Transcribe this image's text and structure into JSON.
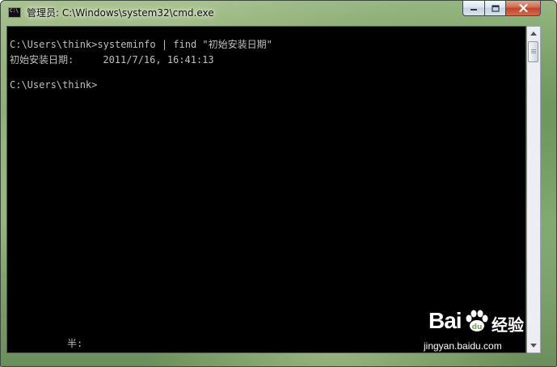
{
  "window": {
    "title": "管理员: C:\\Windows\\system32\\cmd.exe",
    "icon_text": "C:\\"
  },
  "console": {
    "lines": [
      "C:\\Users\\think>systeminfo | find \"初始安装日期\"",
      "初始安装日期:     2011/7/16, 16:41:13",
      "C:\\Users\\think>",
      "半:"
    ]
  },
  "watermark": {
    "logo_left": "Bai",
    "logo_right": "经验",
    "url": "jingyan.baidu.com"
  },
  "colors": {
    "console_bg": "#000000",
    "console_text": "#c0c0c0",
    "close_button": "#c2442a"
  },
  "icons": [
    "cmd-app-icon",
    "minimize-icon",
    "maximize-icon",
    "close-icon",
    "scroll-up-icon",
    "scroll-down-icon",
    "baidu-paw-icon"
  ]
}
